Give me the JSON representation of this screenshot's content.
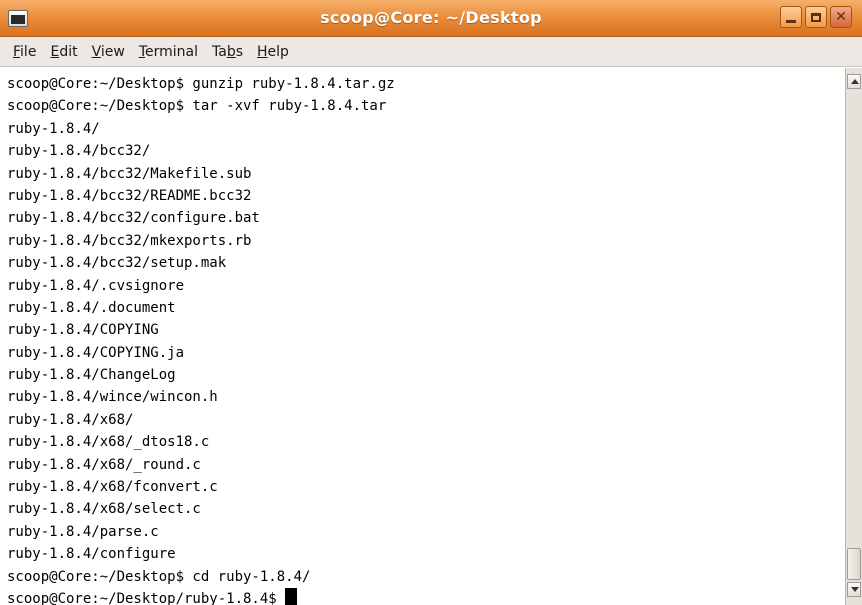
{
  "window": {
    "title": "scoop@Core: ~/Desktop",
    "icon": "terminal-icon",
    "controls": [
      "minimize-icon",
      "maximize-icon",
      "close-icon"
    ],
    "accent_color": "#ec8f3c"
  },
  "menu": {
    "items": [
      {
        "mnemonic": "F",
        "rest": "ile"
      },
      {
        "mnemonic": "E",
        "rest": "dit"
      },
      {
        "mnemonic": "V",
        "rest": "iew"
      },
      {
        "mnemonic": "T",
        "rest": "erminal"
      },
      {
        "pre": "Ta",
        "mnemonic": "b",
        "rest": "s"
      },
      {
        "mnemonic": "H",
        "rest": "elp"
      }
    ]
  },
  "terminal": {
    "lines": [
      "scoop@Core:~/Desktop$ gunzip ruby-1.8.4.tar.gz",
      "scoop@Core:~/Desktop$ tar -xvf ruby-1.8.4.tar",
      "ruby-1.8.4/",
      "ruby-1.8.4/bcc32/",
      "ruby-1.8.4/bcc32/Makefile.sub",
      "ruby-1.8.4/bcc32/README.bcc32",
      "ruby-1.8.4/bcc32/configure.bat",
      "ruby-1.8.4/bcc32/mkexports.rb",
      "ruby-1.8.4/bcc32/setup.mak",
      "ruby-1.8.4/.cvsignore",
      "ruby-1.8.4/.document",
      "ruby-1.8.4/COPYING",
      "ruby-1.8.4/COPYING.ja",
      "ruby-1.8.4/ChangeLog",
      "ruby-1.8.4/wince/wincon.h",
      "ruby-1.8.4/x68/",
      "ruby-1.8.4/x68/_dtos18.c",
      "ruby-1.8.4/x68/_round.c",
      "ruby-1.8.4/x68/fconvert.c",
      "ruby-1.8.4/x68/select.c",
      "ruby-1.8.4/parse.c",
      "ruby-1.8.4/configure",
      "scoop@Core:~/Desktop$ cd ruby-1.8.4/"
    ],
    "prompt": "scoop@Core:~/Desktop/ruby-1.8.4$ "
  }
}
